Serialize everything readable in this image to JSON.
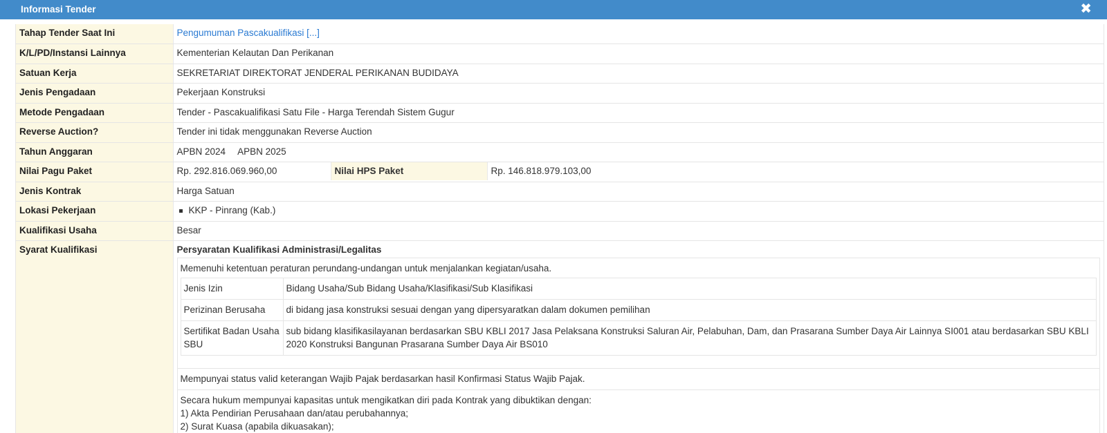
{
  "header": {
    "title": "Informasi Tender",
    "close_icon": "close-icon"
  },
  "rows": {
    "tahap": {
      "label": "Tahap Tender Saat Ini",
      "value": "Pengumuman Pascakualifikasi [...]"
    },
    "klpd": {
      "label": "K/L/PD/Instansi Lainnya",
      "value": "Kementerian Kelautan Dan Perikanan"
    },
    "satker": {
      "label": "Satuan Kerja",
      "value": "SEKRETARIAT DIREKTORAT JENDERAL PERIKANAN BUDIDAYA"
    },
    "jenis_pengadaan": {
      "label": "Jenis Pengadaan",
      "value": "Pekerjaan Konstruksi"
    },
    "metode": {
      "label": "Metode Pengadaan",
      "value": "Tender - Pascakualifikasi Satu File - Harga Terendah Sistem Gugur"
    },
    "reverse": {
      "label": "Reverse Auction?",
      "value": "Tender ini tidak menggunakan Reverse Auction"
    },
    "tahun": {
      "label": "Tahun Anggaran",
      "values": [
        "APBN 2024",
        "APBN 2025"
      ]
    },
    "pagu": {
      "label": "Nilai Pagu Paket",
      "value": "Rp. 292.816.069.960,00",
      "hps_label": "Nilai HPS Paket",
      "hps_value": "Rp. 146.818.979.103,00"
    },
    "kontrak": {
      "label": "Jenis Kontrak",
      "value": "Harga Satuan"
    },
    "lokasi": {
      "label": "Lokasi Pekerjaan",
      "items": [
        "KKP - Pinrang (Kab.)"
      ]
    },
    "kualifikasi": {
      "label": "Kualifikasi Usaha",
      "value": "Besar"
    },
    "syarat": {
      "label": "Syarat Kualifikasi",
      "title": "Persyaratan Kualifikasi Administrasi/Legalitas",
      "p1": "Memenuhi ketentuan peraturan perundang-undangan untuk menjalankan kegiatan/usaha.",
      "izin_table": [
        {
          "k": "Jenis Izin",
          "v": "Bidang Usaha/Sub Bidang Usaha/Klasifikasi/Sub Klasifikasi"
        },
        {
          "k": "Perizinan Berusaha",
          "v": "di bidang jasa konstruksi sesuai dengan yang dipersyaratkan dalam dokumen pemilihan"
        },
        {
          "k": "Sertifikat Badan Usaha SBU",
          "v": "sub bidang klasifikasilayanan berdasarkan SBU KBLI 2017 Jasa Pelaksana Konstruksi Saluran Air, Pelabuhan, Dam, dan Prasarana Sumber Daya Air Lainnya SI001 atau berdasarkan SBU KBLI 2020 Konstruksi Bangunan Prasarana Sumber Daya Air BS010"
        }
      ],
      "p2": "Mempunyai status valid keterangan Wajib Pajak berdasarkan hasil Konfirmasi Status Wajib Pajak.",
      "p3_intro": "Secara hukum mempunyai kapasitas untuk mengikatkan diri pada Kontrak yang dibuktikan dengan:",
      "p3_items": [
        "1) Akta Pendirian Perusahaan dan/atau perubahannya;",
        "2) Surat Kuasa (apabila dikuasakan);"
      ]
    }
  }
}
